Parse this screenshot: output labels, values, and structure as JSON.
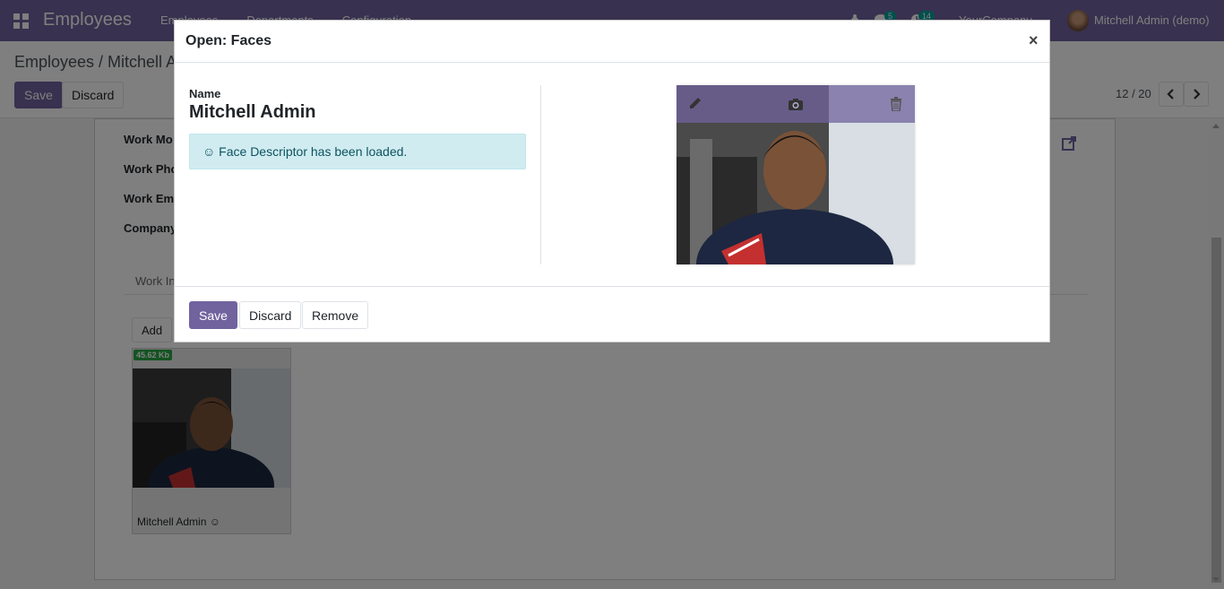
{
  "navbar": {
    "app_title": "Employees",
    "menu": [
      "Employees",
      "Departments",
      "Configuration"
    ],
    "messages_badge": "5",
    "activities_badge": "14",
    "company": "YourCompany",
    "user": "Mitchell Admin (demo)"
  },
  "control_panel": {
    "breadcrumb": "Employees / Mitchell A",
    "save_label": "Save",
    "discard_label": "Discard",
    "pager": "12 / 20"
  },
  "form": {
    "labels": [
      "Work Mo",
      "Work Pho",
      "Work Em",
      "Company"
    ],
    "tab_label": "Work In",
    "add_label": "Add",
    "card_size": "45.62 Kb",
    "card_caption": "Mitchell Admin ☺"
  },
  "modal": {
    "title": "Open: Faces",
    "close": "×",
    "name_label": "Name",
    "name_value": "Mitchell Admin",
    "alert": "☺ Face Descriptor has been loaded.",
    "save_label": "Save",
    "discard_label": "Discard",
    "remove_label": "Remove"
  },
  "colors": {
    "brand": "#71639e",
    "alert_bg": "#d1ecf1",
    "badge": "#00a09d",
    "size_badge": "#28a745"
  }
}
